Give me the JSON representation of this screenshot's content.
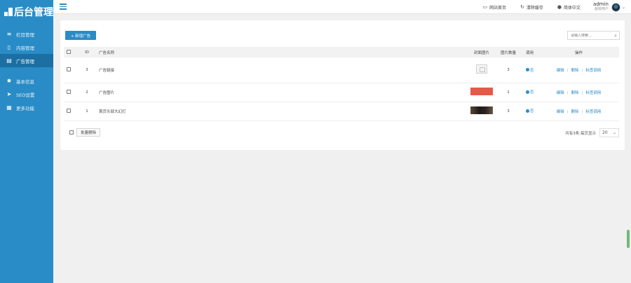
{
  "app": {
    "logo": "后台管理"
  },
  "sidebar": {
    "items": [
      {
        "icon": "list-icon",
        "label": "栏目管理"
      },
      {
        "icon": "document-icon",
        "label": "内容管理"
      },
      {
        "icon": "ad-document-icon",
        "label": "广告管理",
        "active": true
      },
      {
        "icon": "gear-icon",
        "label": "基本信息"
      },
      {
        "icon": "paper-plane-icon",
        "label": "SEO设置"
      },
      {
        "icon": "grid-icon",
        "label": "更多功能"
      }
    ]
  },
  "topbar": {
    "links": [
      {
        "icon": "monitor-icon",
        "label": "网站首页"
      },
      {
        "icon": "refresh-icon",
        "label": "清除缓存"
      },
      {
        "icon": "globe-icon",
        "label": "简体中文"
      }
    ],
    "user": {
      "name": "admin",
      "role": "超级用户"
    }
  },
  "toolbar": {
    "add_label": "+ 新增广告",
    "search_placeholder": "请输入搜索..."
  },
  "table": {
    "headers": {
      "id": "ID",
      "name": "广告名称",
      "image": "封面图片",
      "count": "图片数量",
      "use": "调用",
      "actions": "操作"
    },
    "rows": [
      {
        "id": "3",
        "name": "广告链接",
        "thumb": "none",
        "count": "3",
        "use": "否"
      },
      {
        "id": "2",
        "name": "广告图片",
        "thumb": "red",
        "count": "1",
        "use": "否"
      },
      {
        "id": "1",
        "name": "首页头部大幻灯",
        "thumb": "dark",
        "count": "3",
        "use": "否"
      }
    ],
    "actions": {
      "edit": "编辑",
      "delete": "删除",
      "call": "标签调用"
    }
  },
  "footer": {
    "batch_delete": "批量删除",
    "total_text": "共有3条,每页显示",
    "page_size": "20"
  },
  "colors": {
    "primary": "#2a8cc6",
    "sidebar_active": "#1b6fa3"
  }
}
